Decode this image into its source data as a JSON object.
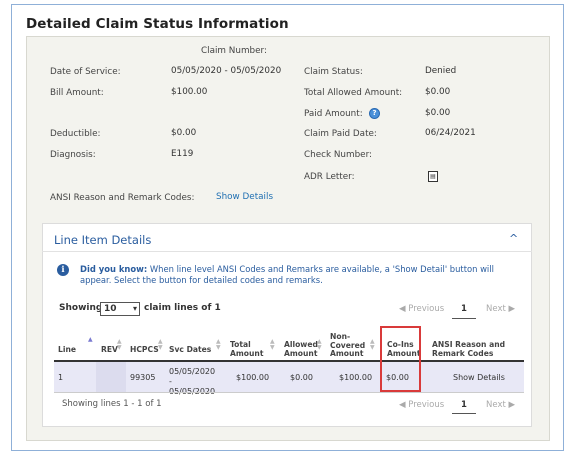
{
  "title": "Detailed Claim Status Information",
  "claim": {
    "claim_number_label": "Claim Number:",
    "claim_number_value": "",
    "date_of_service_label": "Date of Service:",
    "date_of_service_value": "05/05/2020 - 05/05/2020",
    "bill_amount_label": "Bill Amount:",
    "bill_amount_value": "$100.00",
    "deductible_label": "Deductible:",
    "deductible_value": "$0.00",
    "diagnosis_label": "Diagnosis:",
    "diagnosis_value": "E119",
    "claim_status_label": "Claim Status:",
    "claim_status_value": "Denied",
    "total_allowed_label": "Total Allowed Amount:",
    "total_allowed_value": "$0.00",
    "paid_amount_label": "Paid Amount:",
    "paid_amount_value": "$0.00",
    "claim_paid_date_label": "Claim Paid Date:",
    "claim_paid_date_value": "06/24/2021",
    "check_number_label": "Check Number:",
    "check_number_value": "",
    "adr_letter_label": "ADR Letter:",
    "ansi_label": "ANSI Reason and Remark Codes:",
    "ansi_link": "Show Details"
  },
  "icons": {
    "help": "question-circle-icon",
    "document": "pdf-document-icon",
    "info": "info-circle-icon",
    "chevron": "chevron-up-icon"
  },
  "line_items": {
    "title": "Line Item Details",
    "chevron": "^",
    "info_icon_glyph": "i",
    "help_icon_glyph": "?",
    "adr_icon_glyph": "▤",
    "did_you_know_label": "Did you know:",
    "did_you_know_text": "When line level ANSI Codes and Remarks are available, a 'Show Detail' button will appear. Select the button for detailed codes and remarks.",
    "showing_label": "Showing",
    "page_size": "10",
    "claim_lines_text": "claim lines of 1",
    "pagination": {
      "previous": "◀ Previous",
      "current": "1",
      "next": "Next ▶"
    },
    "columns": [
      "Line",
      "REV",
      "HCPCS",
      "Svc Dates",
      "Total Amount",
      "Allowed Amount",
      "Non-Covered Amount",
      "Co-Ins Amount",
      "ANSI Reason and Remark Codes"
    ],
    "rows": [
      {
        "line": "1",
        "rev": "",
        "hcpcs": "99305",
        "svc_dates": "05/05/2020 - 05/05/2020",
        "total": "$100.00",
        "allowed": "$0.00",
        "non_covered": "$100.00",
        "coins": "$0.00",
        "ansi": "Show Details"
      }
    ],
    "footer_text": "Showing lines 1 - 1 of 1"
  },
  "colors": {
    "accent_blue": "#2a5d9f",
    "highlight_red": "#d93a3a",
    "row_bg": "#e8e8f6"
  }
}
